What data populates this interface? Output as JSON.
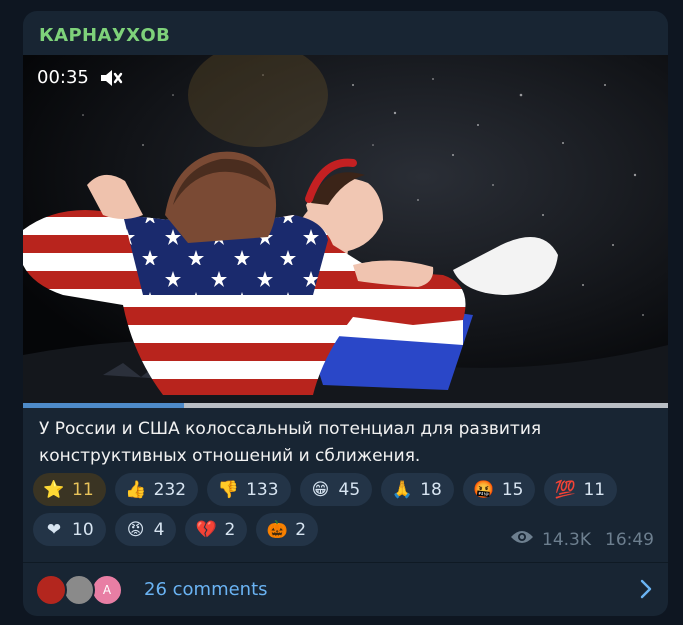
{
  "post": {
    "channel_name": "КАРНАУХОВ",
    "video": {
      "timecode": "00:35",
      "muted_icon": "volume-mute-icon",
      "progress": 0.25
    },
    "caption": "У России и США колоссальный потенциал для развития конструктивных отношений и сближения.",
    "reactions": [
      {
        "icon": "star-icon",
        "emoji": "⭐",
        "count": "11",
        "active": true
      },
      {
        "icon": "thumbs-up-icon",
        "emoji": "👍",
        "count": "232"
      },
      {
        "icon": "thumbs-down-icon",
        "emoji": "👎",
        "count": "133"
      },
      {
        "icon": "grinning-face-icon",
        "emoji": "😁",
        "count": "45"
      },
      {
        "icon": "folded-hands-icon",
        "emoji": "🙏",
        "count": "18"
      },
      {
        "icon": "cursing-face-icon",
        "emoji": "🤬",
        "count": "15"
      },
      {
        "icon": "hundred-points-icon",
        "emoji": "💯",
        "count": "11"
      },
      {
        "icon": "red-heart-icon",
        "emoji": "❤",
        "count": "10"
      },
      {
        "icon": "angry-face-icon",
        "emoji": "😡",
        "count": "4"
      },
      {
        "icon": "broken-heart-icon",
        "emoji": "💔",
        "count": "2"
      },
      {
        "icon": "jack-o-lantern-icon",
        "emoji": "🎃",
        "count": "2"
      }
    ],
    "views": "14.3K",
    "time": "16:49",
    "comments": {
      "label": "26 comments",
      "avatars": [
        {
          "icon": "emblem-avatar-icon",
          "color": "#b3261e",
          "initial": ""
        },
        {
          "icon": "cat-avatar-icon",
          "color": "#8a8a8a",
          "initial": ""
        },
        {
          "icon": "letter-avatar-icon",
          "color": "#e87ea4",
          "initial": "A"
        }
      ]
    }
  },
  "colors": {
    "background": "#0e1621",
    "card": "#182533",
    "channel_name": "#7ed27a",
    "link": "#6ab3f3",
    "meta": "#6d7f8f",
    "progress_fill": "#4e8bc9"
  }
}
